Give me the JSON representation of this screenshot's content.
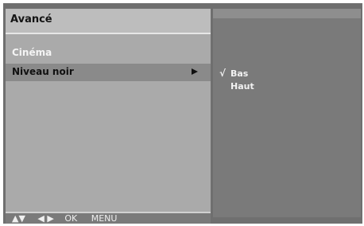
{
  "menu": {
    "title": "Avancé",
    "items": [
      {
        "label": "Cinéma"
      },
      {
        "label": "Niveau noir",
        "arrow": "►"
      }
    ]
  },
  "submenu": {
    "check_mark": "√",
    "options": [
      {
        "label": "Bas",
        "selected": true
      },
      {
        "label": "Haut",
        "selected": false
      }
    ]
  },
  "help": {
    "updown": "▲▼",
    "leftright": "◀ ▶",
    "ok": "OK",
    "menu": "MENU"
  }
}
